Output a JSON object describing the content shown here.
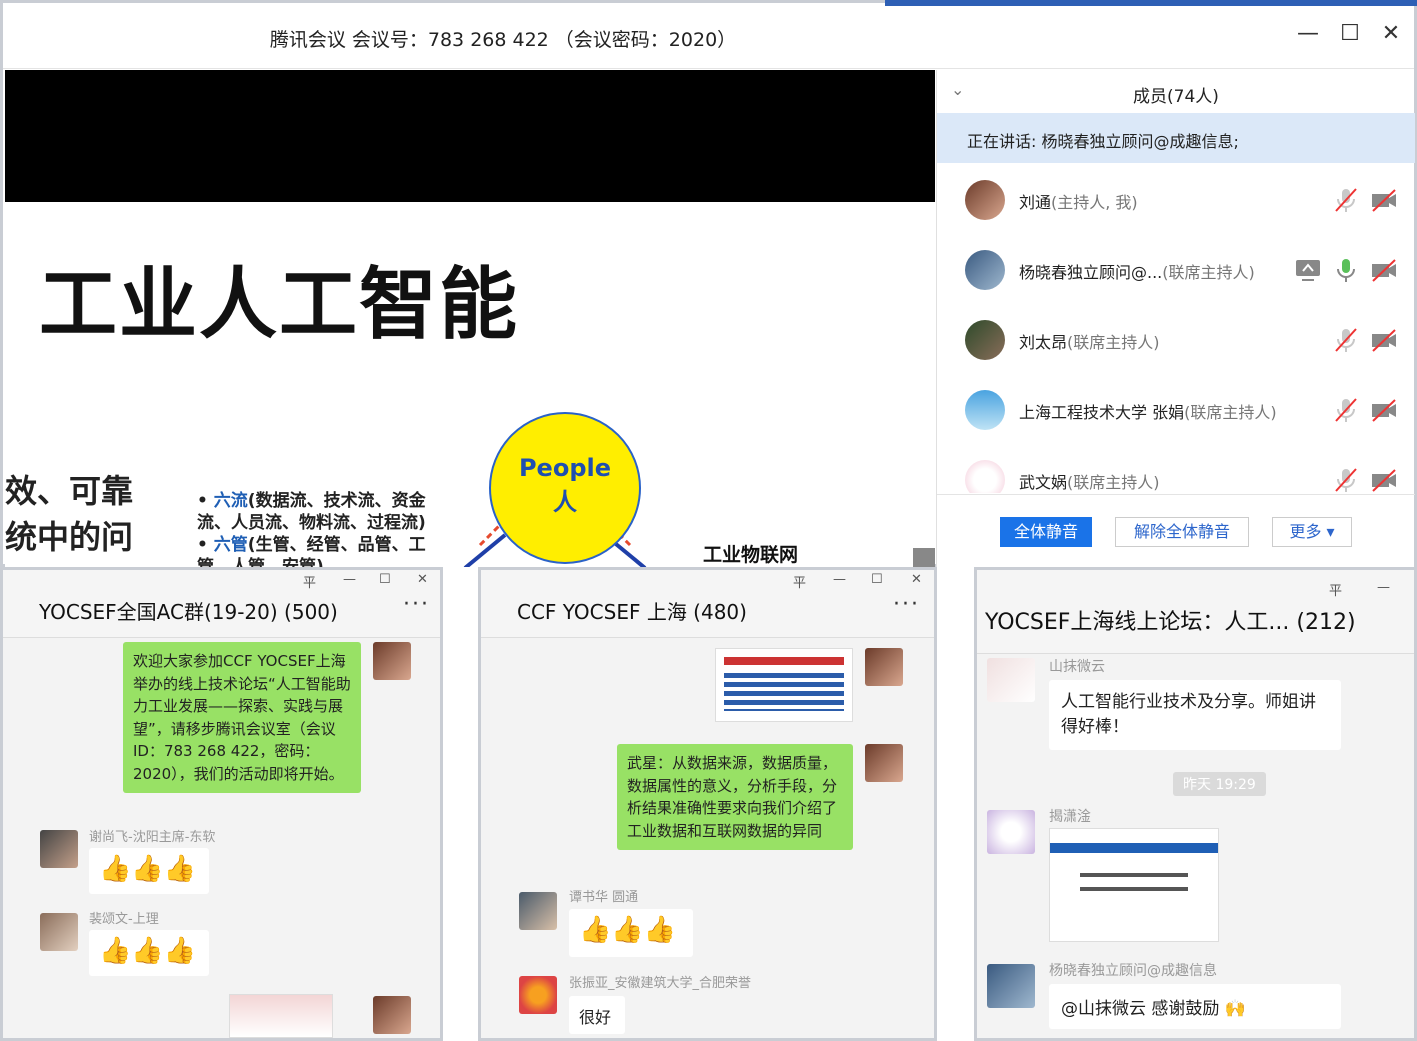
{
  "meeting": {
    "title": "腾讯会议 会议号：783 268 422 （会议密码：2020）",
    "controls": {
      "minimize": "—",
      "maximize": "☐",
      "close": "✕"
    },
    "slide": {
      "main_title": "工业人工智能",
      "left_text_1": "效、可靠",
      "left_text_2": "统中的问",
      "bullet1_key": "六流",
      "bullet1_text": "(数据流、技术流、资金流、人员流、物料流、过程流)",
      "bullet2_key": "六管",
      "bullet2_text": "(生管、经管、品管、工管、人管、安管)",
      "circle_en": "People",
      "circle_cn": "人",
      "iot_label": "工业物联网"
    },
    "members_panel": {
      "header": "成员(74人)",
      "speaking": "正在讲话: 杨晓春独立顾问@成趣信息;",
      "members": [
        {
          "name": "刘通",
          "role": "(主持人, 我)"
        },
        {
          "name": "杨晓春独立顾问@...",
          "role": "(联席主持人)"
        },
        {
          "name": "刘太昂",
          "role": "(联席主持人)"
        },
        {
          "name": "上海工程技术大学 张娟",
          "role": "(联席主持人)"
        },
        {
          "name": "武文娲",
          "role": "(联席主持人)"
        }
      ],
      "buttons": {
        "mute_all": "全体静音",
        "unmute_all": "解除全体静音",
        "more": "更多 ▾"
      }
    }
  },
  "chats": [
    {
      "title": "YOCSEF全国AC群(19-20) (500)",
      "window_controls": [
        "平",
        "—",
        "☐",
        "✕"
      ],
      "messages": {
        "m1": "欢迎大家参加CCF YOCSEF上海举办的线上技术论坛“人工智能助力工业发展——探索、实践与展望”，请移步腾讯会议室（会议ID：783 268 422，密码：2020），我们的活动即将开始。",
        "s2": "谢尚飞-沈阳主席-东软",
        "s3": "裴颂文-上理"
      }
    },
    {
      "title": "CCF YOCSEF 上海 (480)",
      "window_controls": [
        "平",
        "—",
        "☐",
        "✕"
      ],
      "messages": {
        "m2": "武星：从数据来源，数据质量，数据属性的意义，分析手段，分析结果准确性要求向我们介绍了工业数据和互联网数据的异同",
        "s3": "谭书华 圆通",
        "s4": "张振亚_安徽建筑大学_合肥荣誉",
        "m4": "很好"
      }
    },
    {
      "title": "YOCSEF上海线上论坛：人工... (212)",
      "window_controls": [
        "平",
        "—"
      ],
      "messages": {
        "s1": "山抹微云",
        "m1": "人工智能行业技术及分享。师姐讲得好棒！",
        "time": "昨天 19:29",
        "s2": "揭潇淦",
        "s3": "杨晓春独立顾问@成趣信息",
        "m3": "@山抹微云 感谢鼓励"
      }
    }
  ]
}
